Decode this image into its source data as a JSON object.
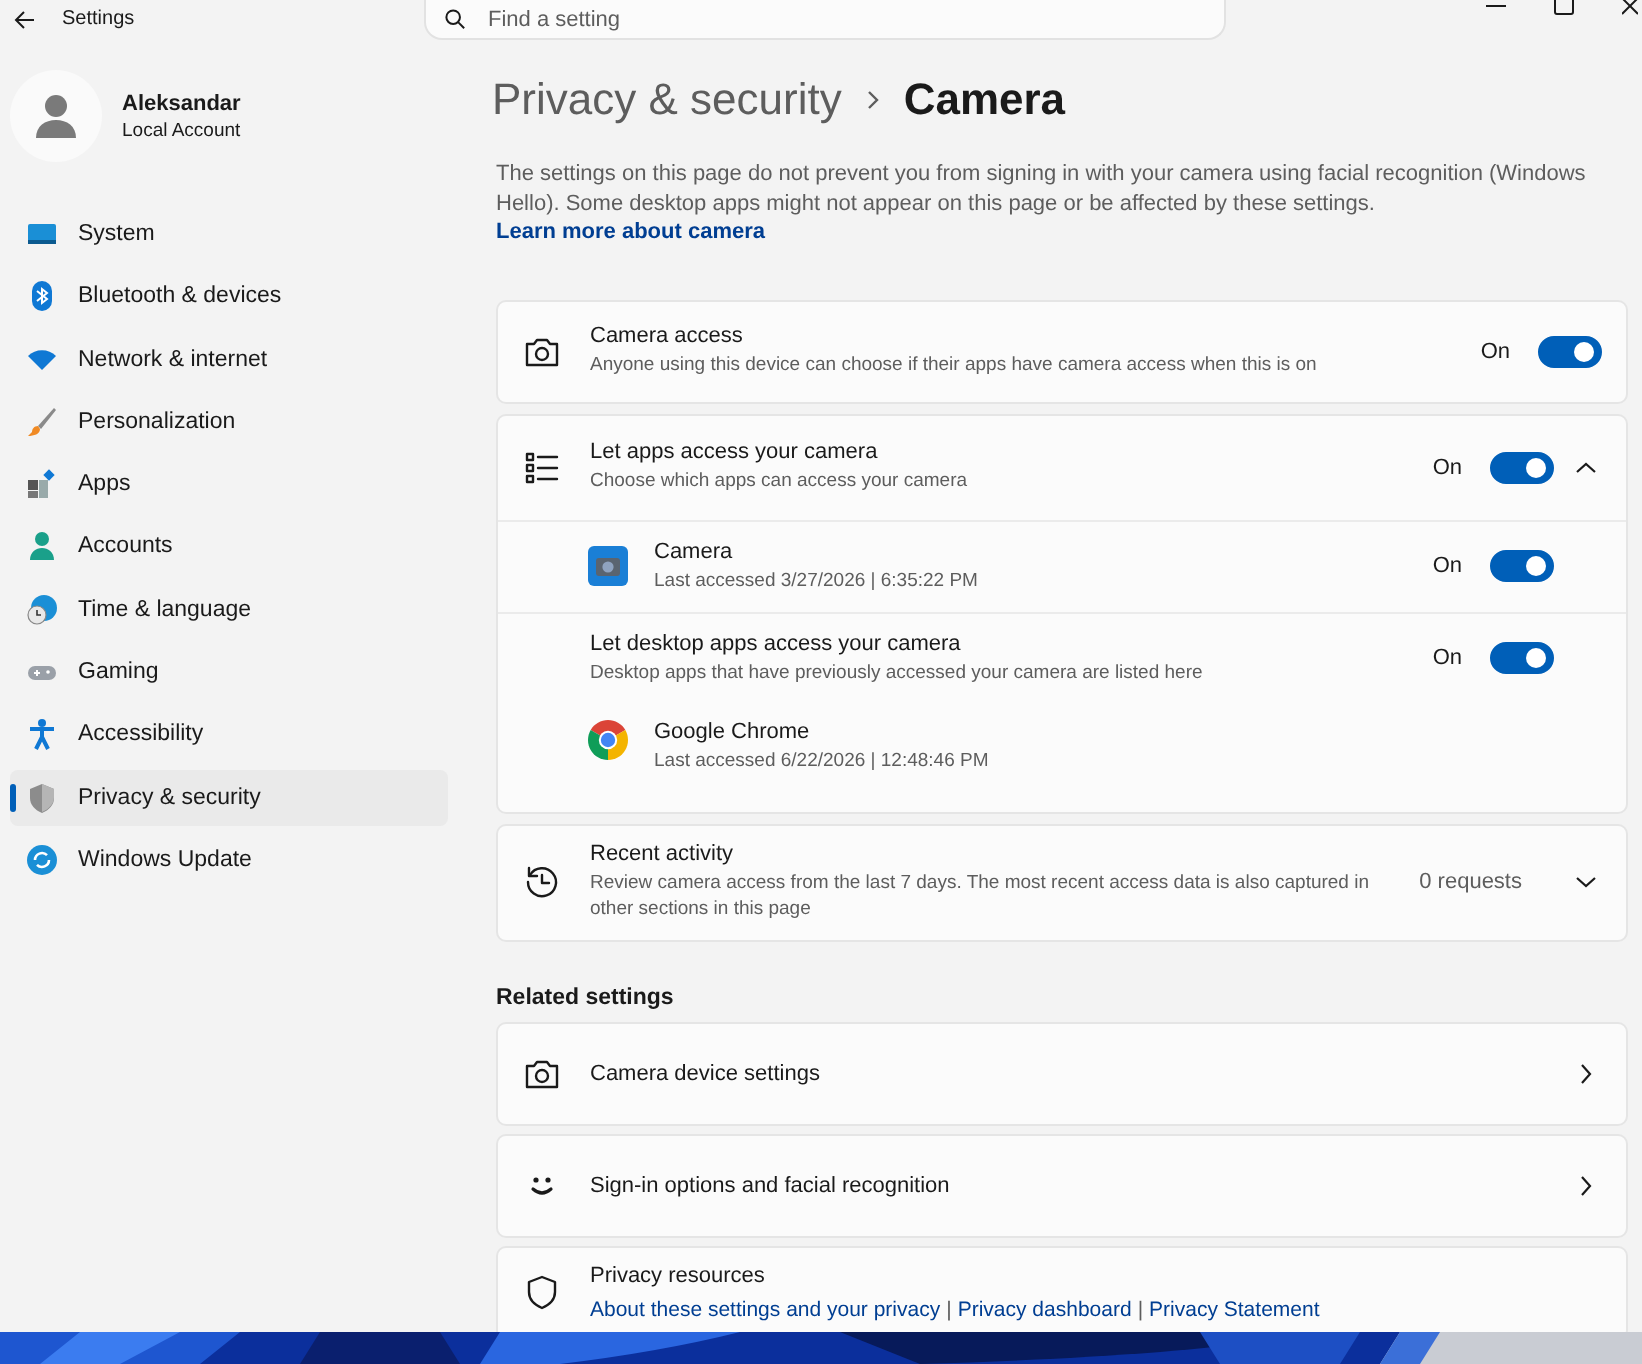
{
  "window": {
    "title": "Settings"
  },
  "search": {
    "placeholder": "Find a setting"
  },
  "account": {
    "name": "Aleksandar",
    "type": "Local Account"
  },
  "sidebar": {
    "items": [
      {
        "kind": "system",
        "label": "System",
        "selected": false
      },
      {
        "kind": "bluetooth",
        "label": "Bluetooth & devices",
        "selected": false
      },
      {
        "kind": "network",
        "label": "Network & internet",
        "selected": false
      },
      {
        "kind": "personalization",
        "label": "Personalization",
        "selected": false
      },
      {
        "kind": "apps",
        "label": "Apps",
        "selected": false
      },
      {
        "kind": "accounts",
        "label": "Accounts",
        "selected": false
      },
      {
        "kind": "time",
        "label": "Time & language",
        "selected": false
      },
      {
        "kind": "gaming",
        "label": "Gaming",
        "selected": false
      },
      {
        "kind": "accessibility",
        "label": "Accessibility",
        "selected": false
      },
      {
        "kind": "privacy",
        "label": "Privacy & security",
        "selected": true
      },
      {
        "kind": "update",
        "label": "Windows Update",
        "selected": false
      }
    ]
  },
  "breadcrumb": {
    "parent": "Privacy & security",
    "current": "Camera"
  },
  "description": {
    "text": "The settings on this page do not prevent you from signing in with your camera using facial recognition (Windows Hello). Some desktop apps might not appear on this page or be affected by these settings.",
    "link": "Learn more about camera"
  },
  "camera_access": {
    "title": "Camera access",
    "subtitle": "Anyone using this device can choose if their apps have camera access when this is on",
    "state": "On",
    "on": true
  },
  "app_access": {
    "title": "Let apps access your camera",
    "subtitle": "Choose which apps can access your camera",
    "state": "On",
    "on": true,
    "expanded": true,
    "apps": [
      {
        "kind": "camera-app",
        "name": "Camera",
        "detail": "Last accessed 3/27/2026  |  6:35:22 PM",
        "state": "On",
        "on": true
      }
    ],
    "desktop": {
      "title": "Let desktop apps access your camera",
      "subtitle": "Desktop apps that have previously accessed your camera are listed here",
      "state": "On",
      "on": true,
      "apps": [
        {
          "kind": "chrome",
          "name": "Google Chrome",
          "detail": "Last accessed 6/22/2026  |  12:48:46 PM"
        }
      ]
    }
  },
  "recent_activity": {
    "title": "Recent activity",
    "subtitle": "Review camera access from the last 7 days. The most recent access data is also captured in other sections in this page",
    "count": "0 requests",
    "expanded": false
  },
  "related_settings": {
    "heading": "Related settings",
    "items": [
      {
        "kind": "camera",
        "label": "Camera device settings"
      },
      {
        "kind": "smile",
        "label": "Sign-in options and facial recognition"
      },
      {
        "kind": "shield",
        "label": "Privacy resources",
        "separator": "|",
        "links": [
          "About these settings and your privacy",
          "Privacy dashboard",
          "Privacy Statement"
        ]
      }
    ]
  }
}
